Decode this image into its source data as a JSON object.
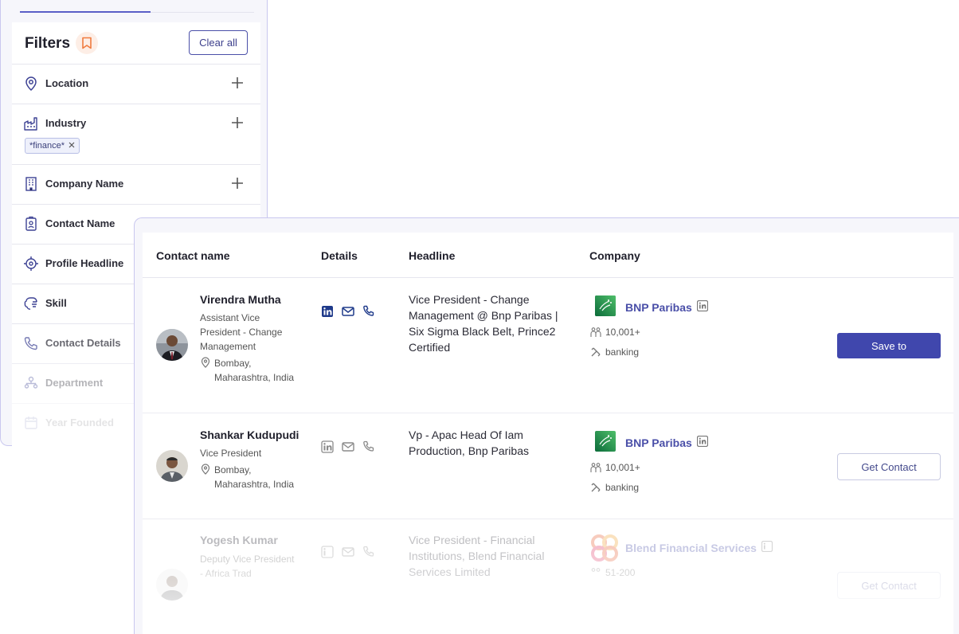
{
  "filters": {
    "title": "Filters",
    "clear_label": "Clear all",
    "items": [
      {
        "label": "Location",
        "icon": "location-pin-icon"
      },
      {
        "label": "Industry",
        "icon": "industry-icon",
        "chip": "*finance*"
      },
      {
        "label": "Company Name",
        "icon": "building-icon"
      },
      {
        "label": "Contact Name",
        "icon": "id-badge-icon"
      },
      {
        "label": "Profile Headline",
        "icon": "target-icon"
      },
      {
        "label": "Skill",
        "icon": "brain-icon"
      },
      {
        "label": "Contact Details",
        "icon": "phone-icon"
      },
      {
        "label": "Department",
        "icon": "org-chart-icon"
      },
      {
        "label": "Year Founded",
        "icon": "calendar-icon"
      }
    ]
  },
  "table": {
    "headers": {
      "contact": "Contact name",
      "details": "Details",
      "headline": "Headline",
      "company": "Company"
    },
    "rows": [
      {
        "name": "Virendra Mutha",
        "title": "Assistant Vice President - Change Management",
        "location": "Bombay, Maharashtra, India",
        "headline": "Vice President - Change Management @ Bnp Paribas | Six Sigma Black Belt, Prince2 Certified",
        "company": "BNP Paribas",
        "employees": "10,001+",
        "industry": "banking",
        "action": "Save to"
      },
      {
        "name": "Shankar Kudupudi",
        "title": "Vice President",
        "location": "Bombay, Maharashtra, India",
        "headline": "Vp - Apac Head Of Iam Production, Bnp Paribas",
        "company": "BNP Paribas",
        "employees": "10,001+",
        "industry": "banking",
        "action": "Get Contact"
      },
      {
        "name": "Yogesh Kumar",
        "title": "Deputy Vice President - Africa Trad",
        "location": "",
        "headline": "Vice President - Financial Institutions, Blend Financial Services Limited",
        "company": "Blend Financial Services",
        "employees": "51-200",
        "industry": "",
        "action": "Get Contact"
      }
    ]
  },
  "colors": {
    "accent": "#4047ad",
    "link": "#4a4fa8",
    "panel_border": "#c9c7ef",
    "bookmark": "#f07b3f"
  }
}
